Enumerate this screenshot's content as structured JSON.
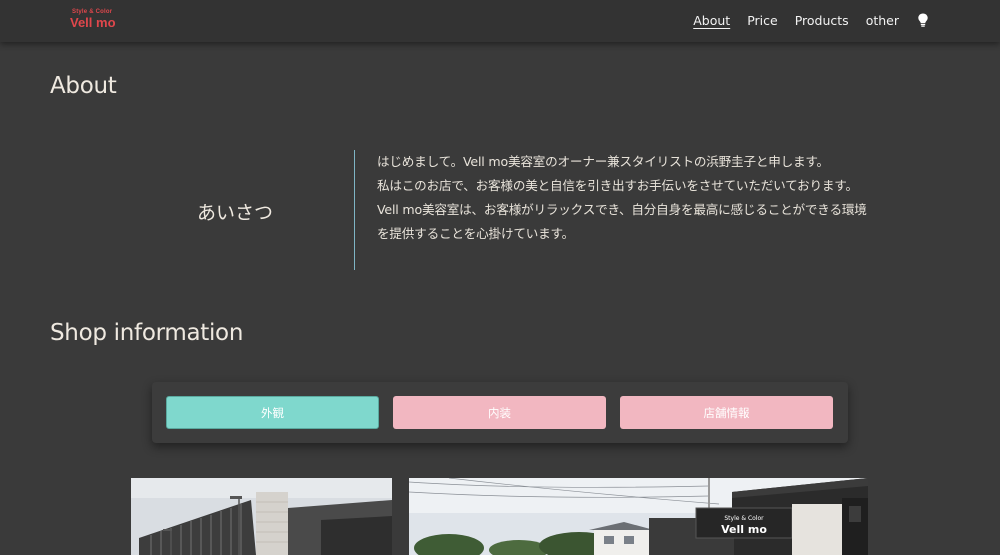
{
  "header": {
    "logo_tagline": "Style & Color",
    "logo_name": "Vell mo",
    "nav": [
      "About",
      "Price",
      "Products",
      "other"
    ],
    "theme_toggle_icon": "lightbulb-icon"
  },
  "about": {
    "title": "About",
    "greeting_label": "あいさつ",
    "greeting_lines": [
      "はじめまして。Vell mo美容室のオーナー兼スタイリストの浜野圭子と申します。",
      "私はこのお店で、お客様の美と自信を引き出すお手伝いをさせていただいております。",
      "Vell mo美容室は、お客様がリラックスでき、自分自身を最高に感じることができる環境を提供することを心掛けています。"
    ]
  },
  "shop": {
    "title": "Shop information",
    "tabs": [
      "外観",
      "内装",
      "店舗情報"
    ],
    "photo_sign_top": "Style & Color",
    "photo_sign_name": "Vell mo"
  },
  "colors": {
    "background": "#3a3a3a",
    "header": "#333333",
    "brand_red": "#e0474c",
    "tab_active": "#7fd8cd",
    "tab_inactive": "#f2b7c1",
    "divider": "#7fb5c5"
  }
}
